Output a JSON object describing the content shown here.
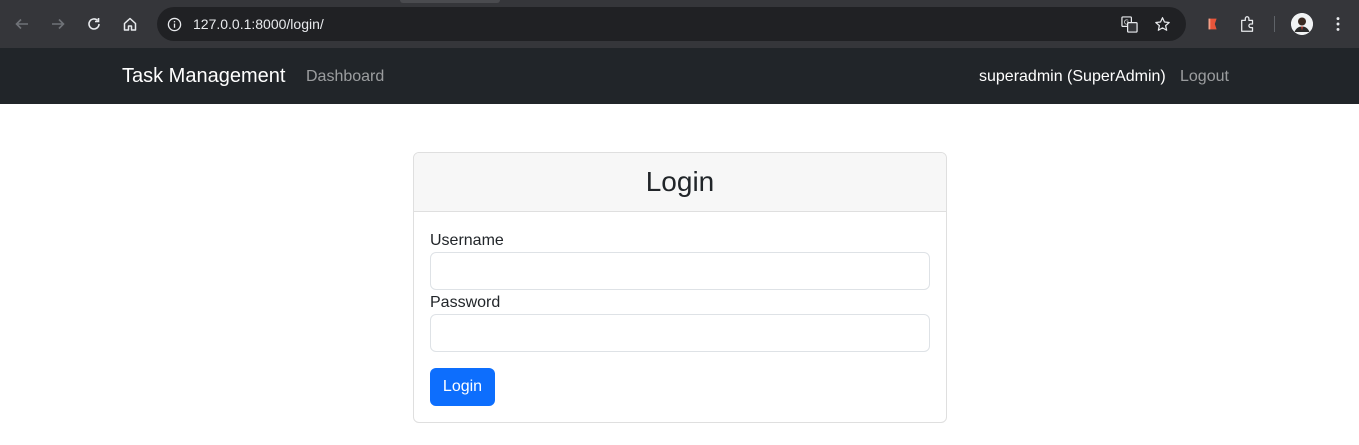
{
  "browser": {
    "url": "127.0.0.1:8000/login/",
    "icons": [
      "back-icon",
      "forward-icon",
      "reload-icon",
      "home-icon",
      "info-icon",
      "translate-icon",
      "star-icon",
      "extension-icon",
      "puzzle-icon",
      "avatar",
      "more-icon"
    ]
  },
  "navbar": {
    "brand": "Task Management",
    "links": {
      "dashboard": "Dashboard",
      "logout": "Logout"
    },
    "user": "superadmin (SuperAdmin)",
    "background": "#212529"
  },
  "card": {
    "title": "Login",
    "username_label": "Username",
    "username_value": "",
    "password_label": "Password",
    "password_value": "",
    "submit_label": "Login",
    "accent": "#0d6efd"
  }
}
